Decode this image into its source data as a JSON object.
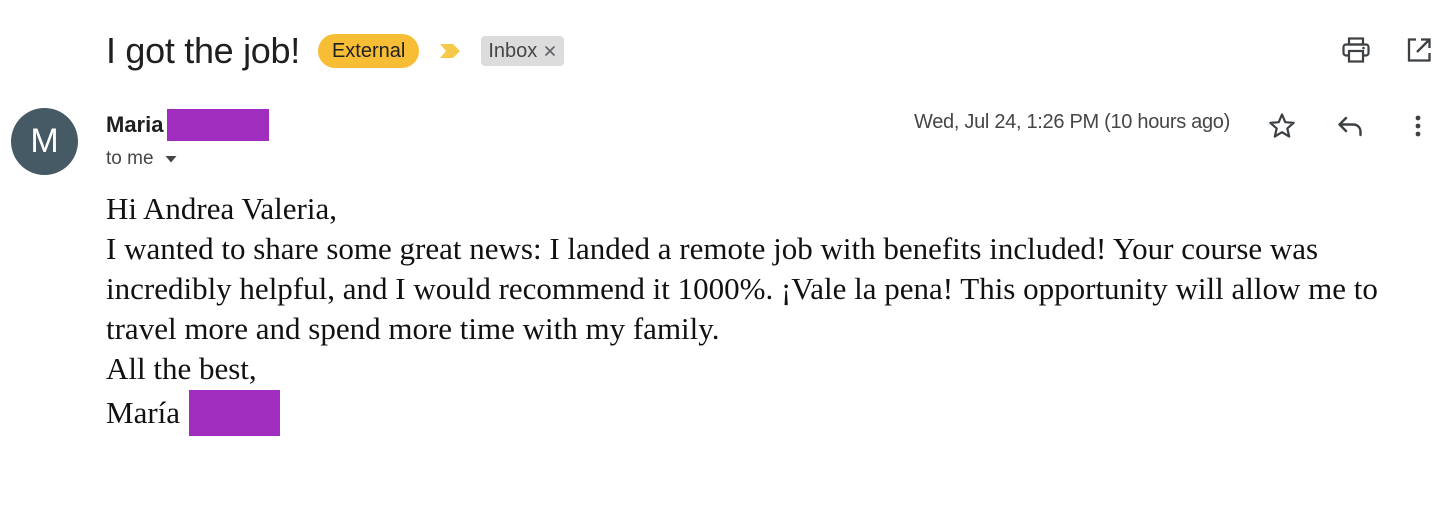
{
  "email": {
    "subject": "I got the job!",
    "labels": {
      "external": "External",
      "inbox": "Inbox"
    },
    "sender": {
      "avatar_initial": "M",
      "name": "Maria",
      "recipient_text": "to me"
    },
    "date": "Wed, Jul 24, 1:26 PM (10 hours ago)",
    "body": {
      "greeting": "Hi Andrea Valeria,",
      "paragraph": "I wanted to share some great news: I landed a remote job with benefits included! Your course was incredibly helpful, and I would recommend it 1000%. ¡Vale la pena! This opportunity will allow me to travel more and spend more time with my family.",
      "closing": "All the best,",
      "signature": "María"
    }
  },
  "colors": {
    "external_label": "#f7bd34",
    "importance_marker": "#f7c948",
    "inbox_label": "#dcdcdc",
    "avatar_background": "#455a64",
    "redaction": "#a12dbf"
  },
  "icons": {
    "importance": "importance-marker-icon",
    "remove_label": "close-icon",
    "print": "print-icon",
    "new_window": "open-in-new-window-icon",
    "details": "chevron-down-icon",
    "star": "star-icon",
    "reply": "reply-icon",
    "more": "more-vertical-icon"
  }
}
